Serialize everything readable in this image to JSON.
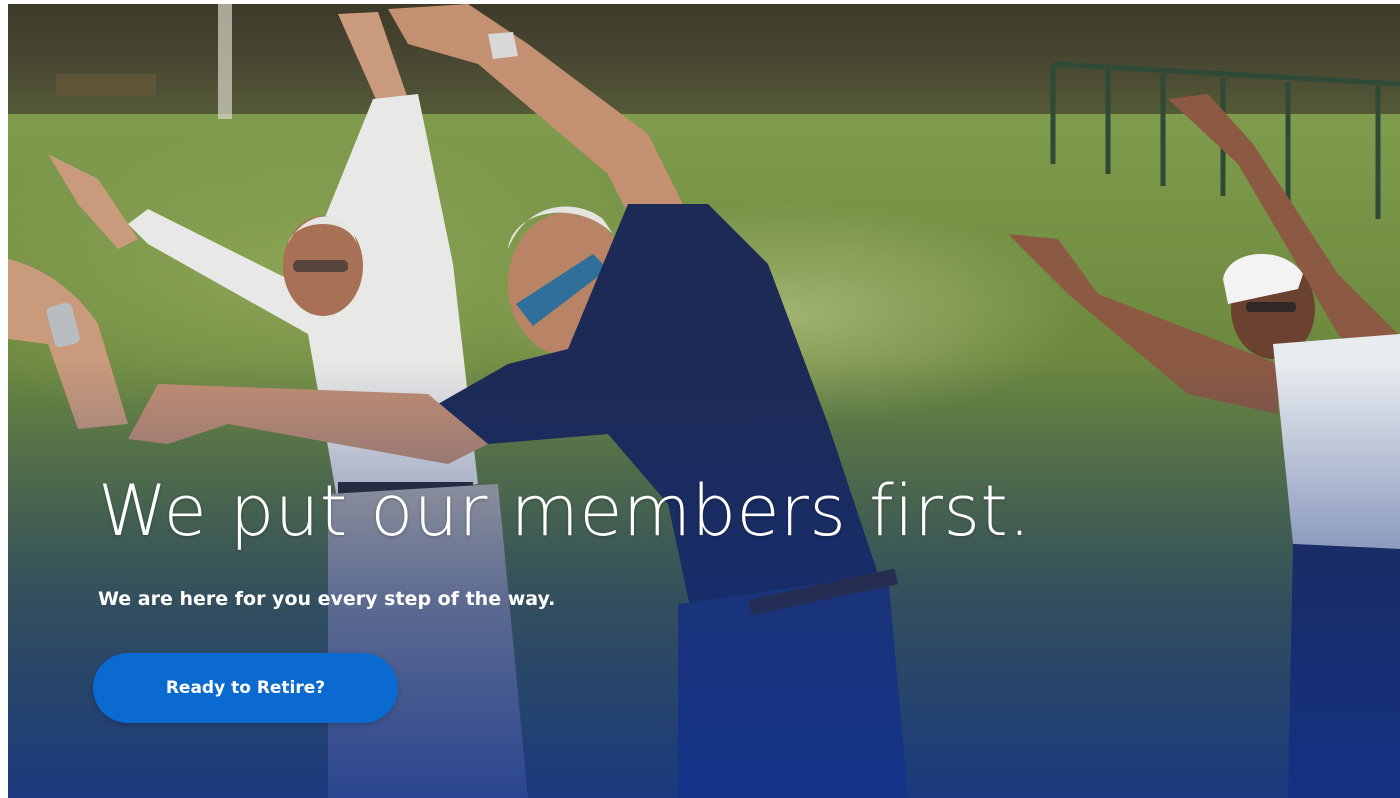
{
  "hero": {
    "headline": "We put our members first.",
    "subheadline": "We are here for you every step of the way.",
    "cta_label": "Ready to Retire?",
    "background_image": "photo-seniors-stretching-outdoors"
  },
  "colors": {
    "button": "#0a6ad0",
    "overlay": "#12308c",
    "text": "#ffffff"
  }
}
